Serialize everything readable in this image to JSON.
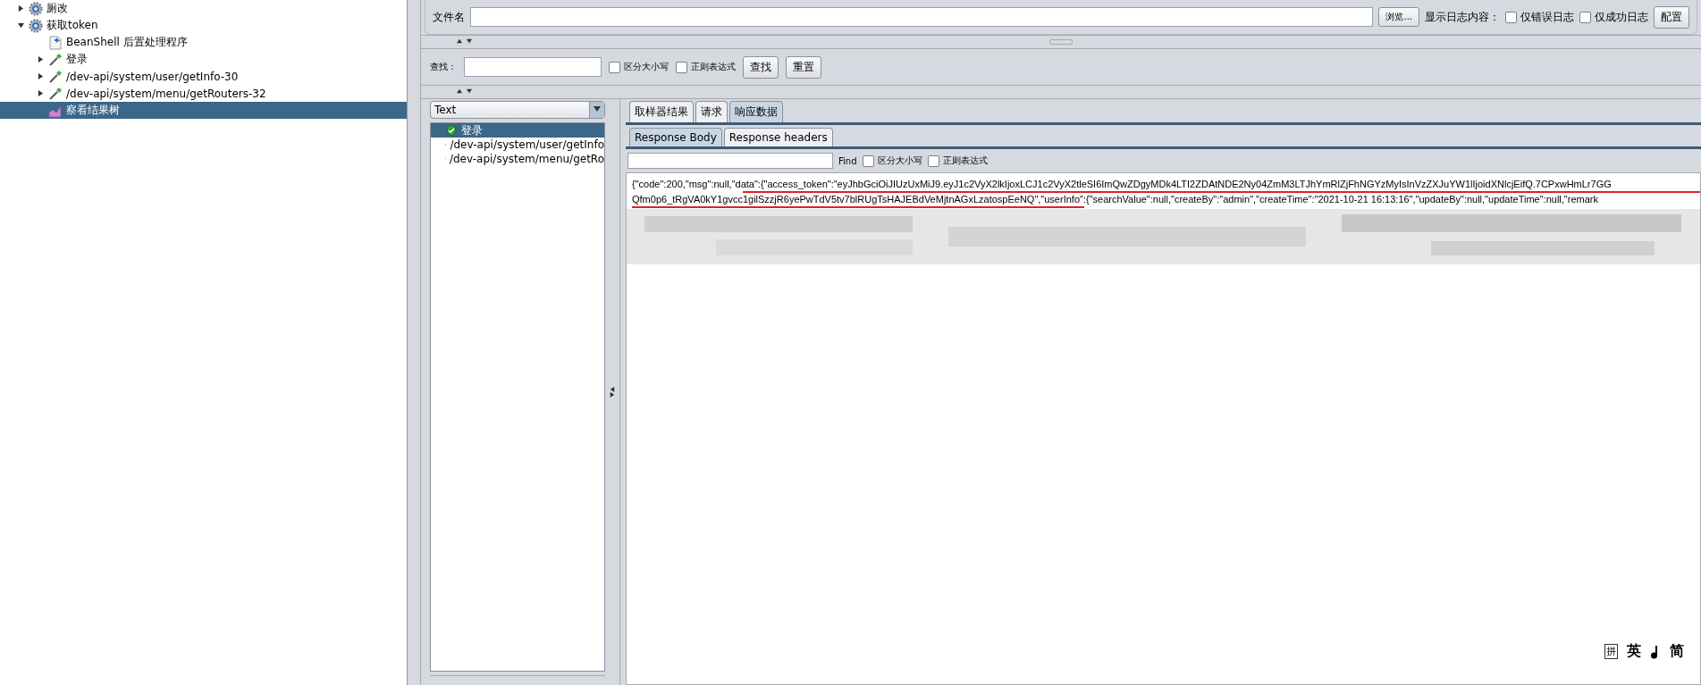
{
  "tree": [
    {
      "label": "厕改",
      "kind": "gear",
      "expanded": false,
      "selected": false
    },
    {
      "label": "获取token",
      "kind": "gear",
      "expanded": true,
      "selected": false,
      "children": [
        {
          "label": "BeanShell 后置处理程序",
          "kind": "script",
          "selected": false
        },
        {
          "label": "登录",
          "kind": "pipette",
          "expanded": false,
          "selected": false
        },
        {
          "label": "/dev-api/system/user/getInfo-30",
          "kind": "pipette",
          "expanded": false,
          "selected": false
        },
        {
          "label": "/dev-api/system/menu/getRouters-32",
          "kind": "pipette",
          "expanded": false,
          "selected": false
        },
        {
          "label": "察看结果树",
          "kind": "chart",
          "selected": true
        }
      ]
    }
  ],
  "file_row": {
    "label": "文件名",
    "browse": "浏览...",
    "log_label": "显示日志内容：",
    "checks": [
      {
        "label": "仅错误日志",
        "checked": false
      },
      {
        "label": "仅成功日志",
        "checked": false
      }
    ],
    "config": "配置"
  },
  "search_row": {
    "label": "查找：",
    "checks": [
      {
        "label": "区分大小写",
        "checked": false
      },
      {
        "label": "正则表达式",
        "checked": false
      }
    ],
    "buttons": [
      "查找",
      "重置"
    ]
  },
  "renderer": {
    "value": "Text"
  },
  "results": [
    {
      "label": "登录",
      "selected": true
    },
    {
      "label": "/dev-api/system/user/getInfo",
      "selected": false
    },
    {
      "label": "/dev-api/system/menu/getRo",
      "selected": false
    }
  ],
  "tabs": [
    {
      "label": "取样器结果",
      "selected": false
    },
    {
      "label": "请求",
      "selected": false
    },
    {
      "label": "响应数据",
      "selected": true
    }
  ],
  "subtabs": [
    {
      "label": "Response Body",
      "selected": true
    },
    {
      "label": "Response headers",
      "selected": false
    }
  ],
  "find_row": {
    "label": "Find",
    "checks": [
      {
        "label": "区分大小写",
        "checked": false
      },
      {
        "label": "正则表达式",
        "checked": false
      }
    ]
  },
  "response_lines": [
    "{\"code\":200,\"msg\":null,\"data\":{\"access_token\":\"eyJhbGciOiJIUzUxMiJ9.eyJ1c2VyX2lkIjoxLCJ1c2VyX2tleSI6ImQwZDgyMDk4LTI2ZDAtNDE2Ny04ZmM3LTJhYmRlZjFhNGYzMyIsInVzZXJuYW1lIjoidXNlcjEifQ.7CPxwHmLr7GG",
    "Qfm0p6_tRgVA0kY1gvcc1gilSzzjR6yePwTdV5tv7blRUgTsHAJEBdVeMjtnAGxLzatospEeNQ\",\"userInfo\":{\"searchValue\":null,\"createBy\":\"admin\",\"createTime\":\"2021-10-21 16:13:16\",\"updateBy\":null,\"updateTime\":null,\"remark"
  ],
  "ime": [
    "拼",
    "英",
    "简"
  ]
}
